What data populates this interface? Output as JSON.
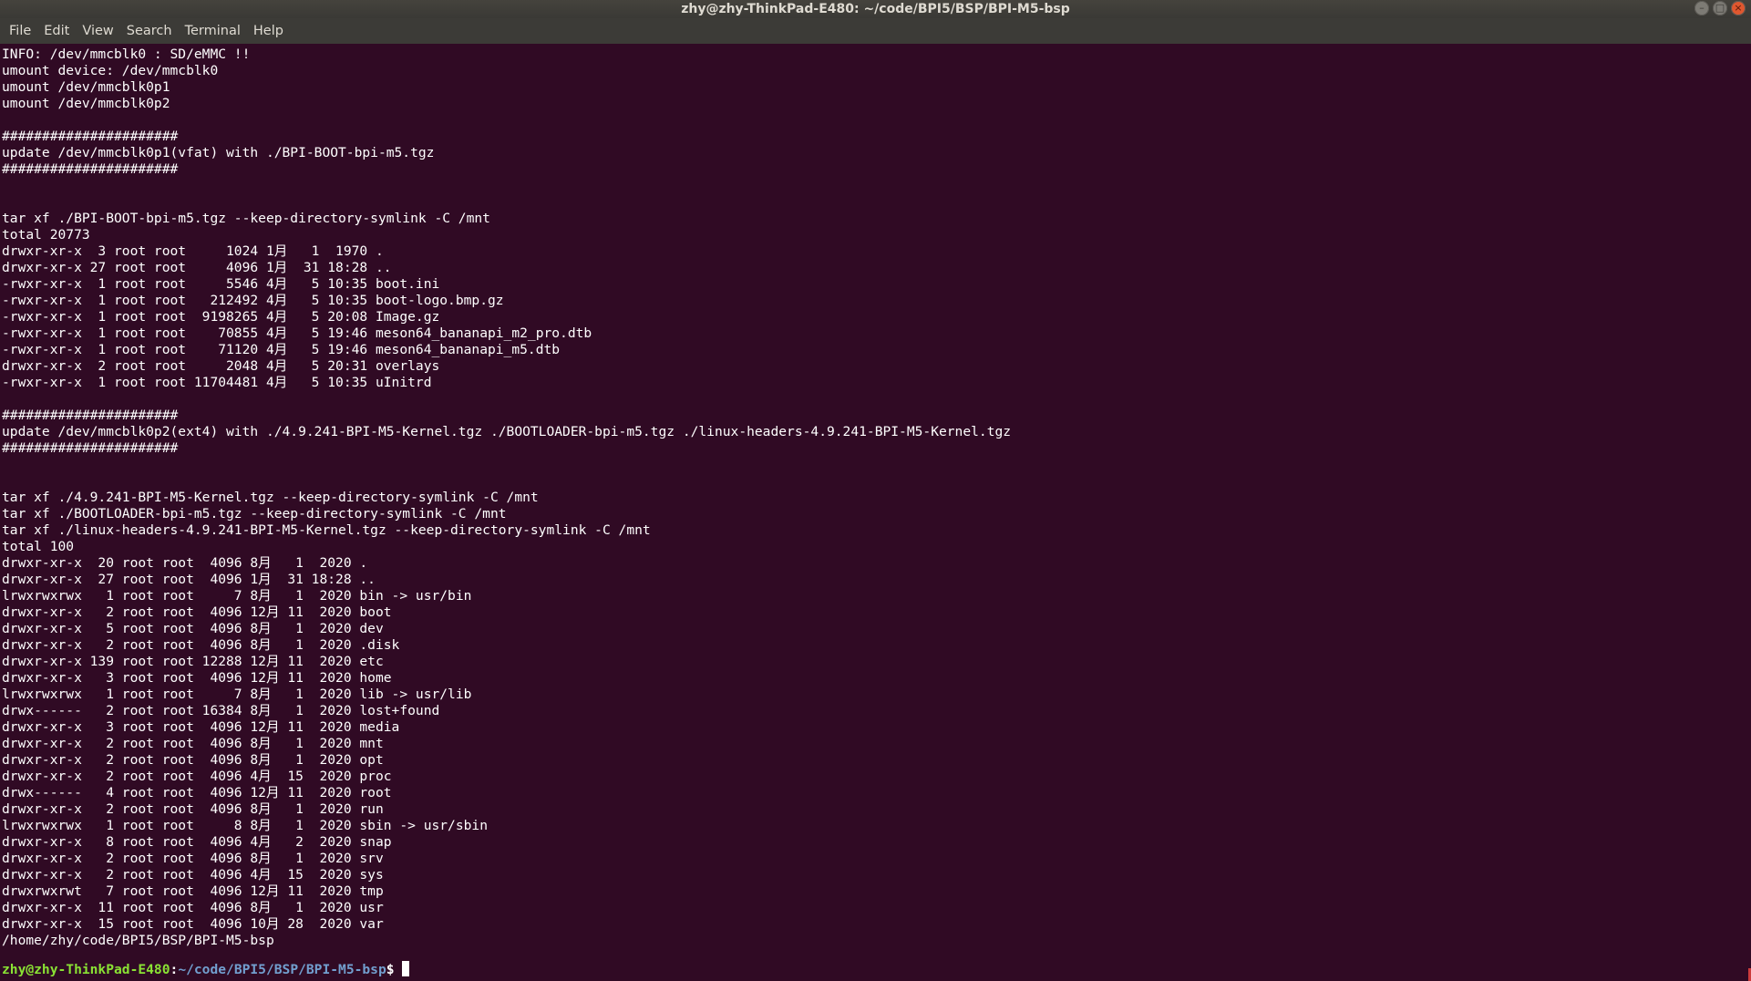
{
  "window": {
    "title": "zhy@zhy-ThinkPad-E480: ~/code/BPI5/BSP/BPI-M5-bsp",
    "buttons": {
      "minimize": "–",
      "maximize": "□",
      "close": "×"
    }
  },
  "menu": [
    "File",
    "Edit",
    "View",
    "Search",
    "Terminal",
    "Help"
  ],
  "terminal": {
    "output": "INFO: /dev/mmcblk0 : SD/eMMC !!\numount device: /dev/mmcblk0\numount /dev/mmcblk0p1\numount /dev/mmcblk0p2\n\n######################\nupdate /dev/mmcblk0p1(vfat) with ./BPI-BOOT-bpi-m5.tgz\n######################\n\n\ntar xf ./BPI-BOOT-bpi-m5.tgz --keep-directory-symlink -C /mnt\ntotal 20773\ndrwxr-xr-x  3 root root     1024 1月   1  1970 .\ndrwxr-xr-x 27 root root     4096 1月  31 18:28 ..\n-rwxr-xr-x  1 root root     5546 4月   5 10:35 boot.ini\n-rwxr-xr-x  1 root root   212492 4月   5 10:35 boot-logo.bmp.gz\n-rwxr-xr-x  1 root root  9198265 4月   5 20:08 Image.gz\n-rwxr-xr-x  1 root root    70855 4月   5 19:46 meson64_bananapi_m2_pro.dtb\n-rwxr-xr-x  1 root root    71120 4月   5 19:46 meson64_bananapi_m5.dtb\ndrwxr-xr-x  2 root root     2048 4月   5 20:31 overlays\n-rwxr-xr-x  1 root root 11704481 4月   5 10:35 uInitrd\n\n######################\nupdate /dev/mmcblk0p2(ext4) with ./4.9.241-BPI-M5-Kernel.tgz ./BOOTLOADER-bpi-m5.tgz ./linux-headers-4.9.241-BPI-M5-Kernel.tgz\n######################\n\n\ntar xf ./4.9.241-BPI-M5-Kernel.tgz --keep-directory-symlink -C /mnt\ntar xf ./BOOTLOADER-bpi-m5.tgz --keep-directory-symlink -C /mnt\ntar xf ./linux-headers-4.9.241-BPI-M5-Kernel.tgz --keep-directory-symlink -C /mnt\ntotal 100\ndrwxr-xr-x  20 root root  4096 8月   1  2020 .\ndrwxr-xr-x  27 root root  4096 1月  31 18:28 ..\nlrwxrwxrwx   1 root root     7 8月   1  2020 bin -> usr/bin\ndrwxr-xr-x   2 root root  4096 12月 11  2020 boot\ndrwxr-xr-x   5 root root  4096 8月   1  2020 dev\ndrwxr-xr-x   2 root root  4096 8月   1  2020 .disk\ndrwxr-xr-x 139 root root 12288 12月 11  2020 etc\ndrwxr-xr-x   3 root root  4096 12月 11  2020 home\nlrwxrwxrwx   1 root root     7 8月   1  2020 lib -> usr/lib\ndrwx------   2 root root 16384 8月   1  2020 lost+found\ndrwxr-xr-x   3 root root  4096 12月 11  2020 media\ndrwxr-xr-x   2 root root  4096 8月   1  2020 mnt\ndrwxr-xr-x   2 root root  4096 8月   1  2020 opt\ndrwxr-xr-x   2 root root  4096 4月  15  2020 proc\ndrwx------   4 root root  4096 12月 11  2020 root\ndrwxr-xr-x   2 root root  4096 8月   1  2020 run\nlrwxrwxrwx   1 root root     8 8月   1  2020 sbin -> usr/sbin\ndrwxr-xr-x   8 root root  4096 4月   2  2020 snap\ndrwxr-xr-x   2 root root  4096 8月   1  2020 srv\ndrwxr-xr-x   2 root root  4096 4月  15  2020 sys\ndrwxrwxrwt   7 root root  4096 12月 11  2020 tmp\ndrwxr-xr-x  11 root root  4096 8月   1  2020 usr\ndrwxr-xr-x  15 root root  4096 10月 28  2020 var\n/home/zhy/code/BPI5/BSP/BPI-M5-bsp\n",
    "prompt": {
      "user_host": "zhy@zhy-ThinkPad-E480",
      "separator": ":",
      "path": "~/code/BPI5/BSP/BPI-M5-bsp",
      "symbol": "$"
    },
    "colors": {
      "background": "#300a24",
      "foreground": "#ffffff",
      "prompt_user": "#8ae234",
      "prompt_path": "#729fcf"
    }
  }
}
